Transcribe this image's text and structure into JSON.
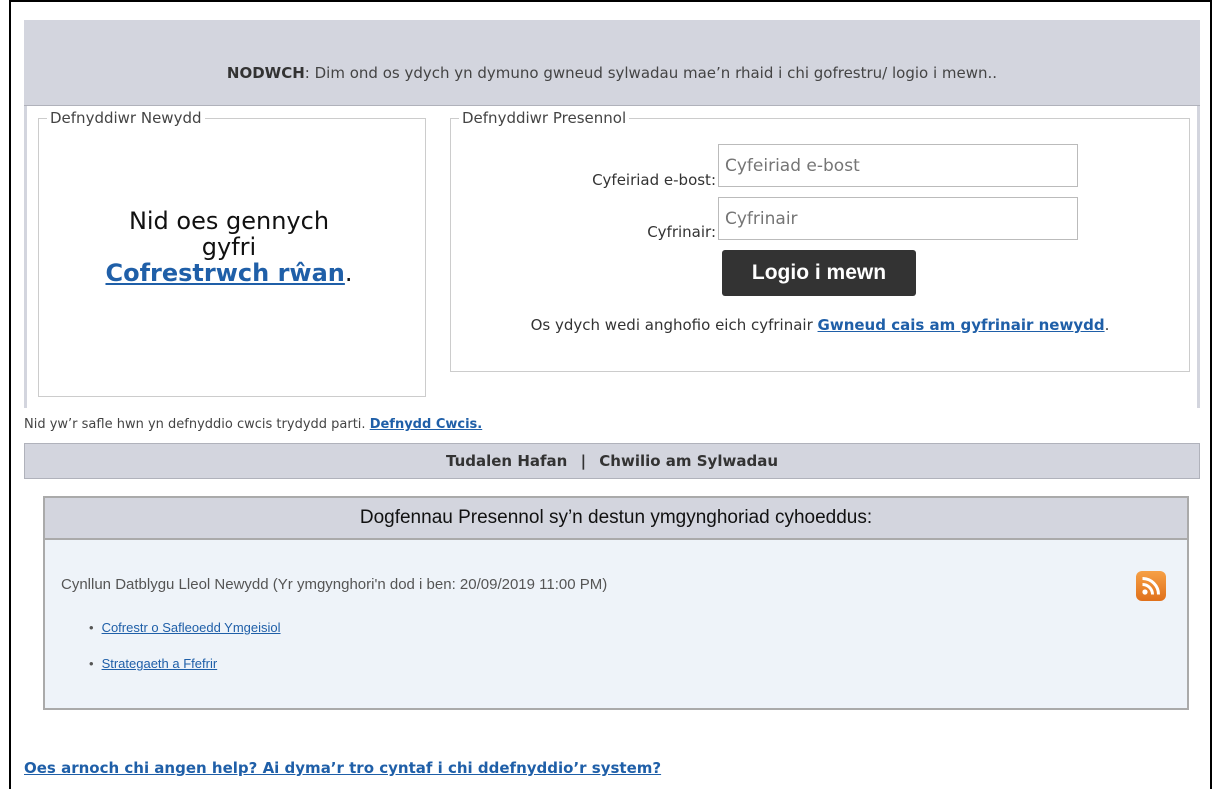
{
  "notice": {
    "prefix": "NODWCH",
    "text": ": Dim ond os ydych yn dymuno gwneud sylwadau mae’n rhaid i chi gofrestru/ logio i mewn.."
  },
  "new_user": {
    "legend": "Defnyddiwr Newydd",
    "line1": "Nid oes gennych",
    "line2": "gyfri",
    "register_link": "Cofrestrwch rŵan",
    "suffix": "."
  },
  "existing_user": {
    "legend": "Defnyddiwr Presennol",
    "email_label": "Cyfeiriad e-bost:",
    "email_placeholder": "Cyfeiriad e-bost",
    "password_label": "Cyfrinair:",
    "password_placeholder": "Cyfrinair",
    "login_button": "Logio i mewn",
    "forgot_text": "Os ydych wedi anghofio eich cyfrinair ",
    "forgot_link": "Gwneud cais am gyfrinair newydd",
    "forgot_suffix": "."
  },
  "cookie": {
    "text": "Nid yw’r safle hwn yn defnyddio cwcis trydydd parti. ",
    "link": "Defnydd Cwcis."
  },
  "nav": {
    "home": "Tudalen Hafan",
    "separator": "|",
    "search": "Chwilio am Sylwadau"
  },
  "documents": {
    "header": "Dogfennau Presennol sy’n destun ymgynghoriad cyhoeddus:",
    "consultation": "Cynllun Datblygu Lleol Newydd (Yr ymgynghori'n dod i ben: 20/09/2019 11:00 PM)",
    "rss_icon": "rss-feed-icon",
    "items": [
      {
        "label": "Cofrestr o Safleoedd Ymgeisiol"
      },
      {
        "label": "Strategaeth a Ffefrir"
      }
    ]
  },
  "help_link": "Oes arnoch chi angen help? Ai dyma’r tro cyntaf i chi ddefnyddio’r system?",
  "colors": {
    "panel_grey": "#d3d5de",
    "link_blue": "#1f5fa8",
    "button_dark": "#333333",
    "rss_orange": "#e0701b"
  }
}
